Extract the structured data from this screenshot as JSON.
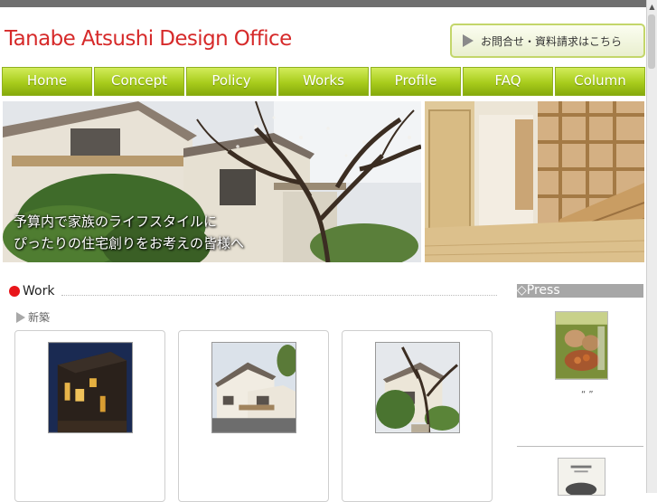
{
  "header": {
    "site_title": "Tanabe Atsushi Design Office",
    "contact_label": "お問合せ・資料請求はこちら"
  },
  "nav": {
    "items": [
      {
        "label": "Home"
      },
      {
        "label": "Concept"
      },
      {
        "label": "Policy"
      },
      {
        "label": "Works"
      },
      {
        "label": "Profile"
      },
      {
        "label": "FAQ"
      },
      {
        "label": "Column"
      }
    ]
  },
  "hero": {
    "caption_line1": "予算内で家族のライフスタイルに",
    "caption_line2": "ぴったりの住宅創りをお考えの皆様へ"
  },
  "work": {
    "title": "Work",
    "subheading": "新築"
  },
  "press": {
    "title": "◇Press",
    "quote": "“ ”"
  },
  "colors": {
    "accent_green": "#a8cc1c",
    "title_red": "#d62a2a",
    "bullet_red": "#e8151a"
  }
}
